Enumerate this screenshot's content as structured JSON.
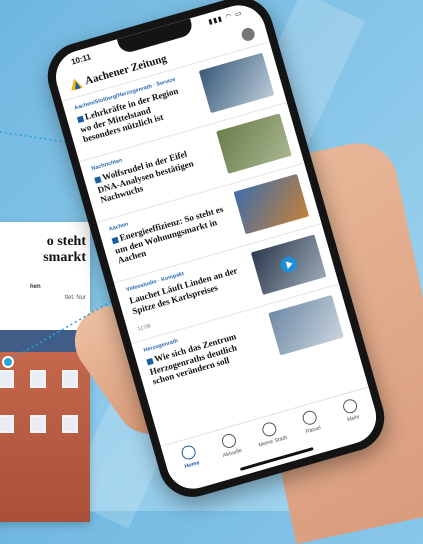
{
  "article_card": {
    "title": "o steht\nsmarkt",
    "meta": "hen",
    "body": "ttet. Nur"
  },
  "app": {
    "title": "Aachener Zeitung",
    "status_time": "10:11",
    "status_icons": "▮▮▮ ◠ ▭"
  },
  "news": [
    {
      "kicker": "Aachen/Stolberg/Herzogenrath · Service",
      "headline": "Lehrkräfte in der Region\nwo der Mittelstand\nbesonders nützlich ist",
      "meta": "",
      "thumb_colors": [
        "#3a5a7a",
        "#b9cbd8"
      ],
      "plus": true
    },
    {
      "kicker": "Nachrichten",
      "headline": "Wolfsrudel in der Eifel\nDNA-Analysen bestätigen\nNachwuchs",
      "meta": "",
      "thumb_colors": [
        "#6b7d4a",
        "#a8b690"
      ],
      "plus": true
    },
    {
      "kicker": "Aachen",
      "headline": "Energieeffizienz: So steht es\num den Wohnungsmarkt in\nAachen",
      "meta": "",
      "thumb_colors": [
        "#3f6ea8",
        "#c4803c"
      ],
      "plus": true
    },
    {
      "kicker": "Videostudio · Kompakt",
      "headline": "Lauchet Läuft Linden an der\nSpitze des Karlspreises",
      "meta": "11:08",
      "thumb_colors": [
        "#2c3a4e",
        "#9aa7b5"
      ],
      "plus": false,
      "video": true
    },
    {
      "kicker": "Herzogenrath",
      "headline": "Wie sich das Zentrum\nHerzogenraths deutlich\nschon verändern soll",
      "meta": "",
      "thumb_colors": [
        "#6f8aa6",
        "#c9d3dd"
      ],
      "plus": true
    }
  ],
  "tabs": [
    {
      "label": "Home",
      "icon": "home-icon",
      "active": true
    },
    {
      "label": "Aktuelle",
      "icon": "clock-icon",
      "active": false
    },
    {
      "label": "Meine Stadt",
      "icon": "location-icon",
      "active": false
    },
    {
      "label": "Rätsel",
      "icon": "puzzle-icon",
      "active": false
    },
    {
      "label": "Mehr",
      "icon": "menu-icon",
      "active": false
    }
  ],
  "colors": {
    "background": "#8cc9ea",
    "brand_blue": "#1b5ea8",
    "brand_yellow": "#f5b800",
    "connector": "#2aa3d8"
  }
}
